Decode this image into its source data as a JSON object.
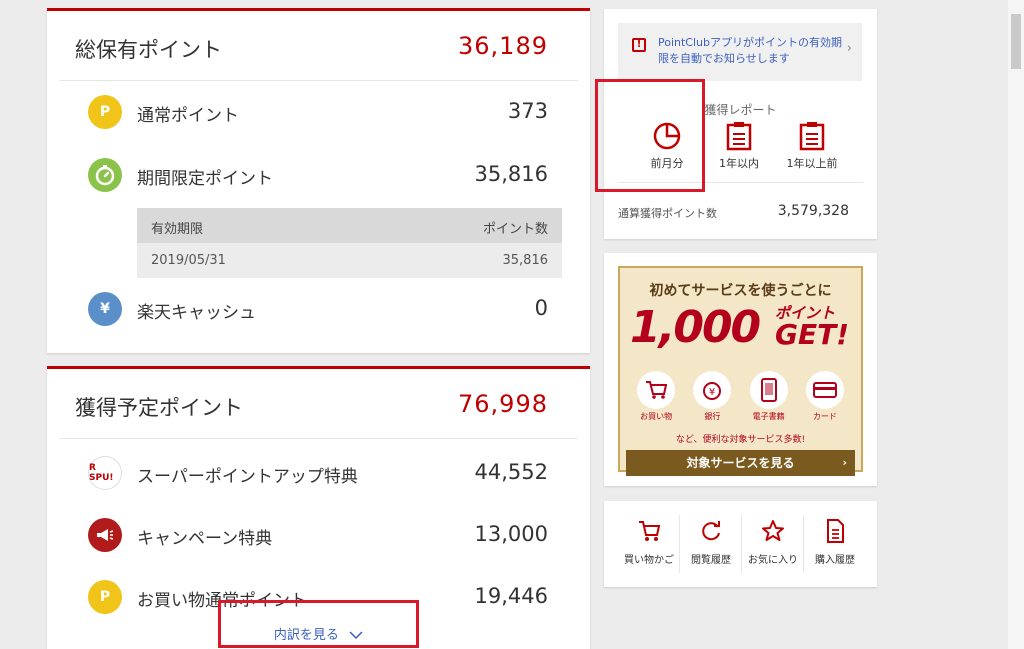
{
  "total": {
    "title": "総保有ポイント",
    "value": "36,189",
    "rows": [
      {
        "icon": "P",
        "label": "通常ポイント",
        "value": "373"
      },
      {
        "label": "期間限定ポイント",
        "value": "35,816"
      },
      {
        "icon": "¥",
        "label": "楽天キャッシュ",
        "value": "0"
      }
    ],
    "expiry": {
      "head_left": "有効期限",
      "head_right": "ポイント数",
      "date": "2019/05/31",
      "points": "35,816"
    }
  },
  "planned": {
    "title": "獲得予定ポイント",
    "value": "76,998",
    "rows": [
      {
        "icon": "R SPU!",
        "label": "スーパーポイントアップ特典",
        "value": "44,552"
      },
      {
        "label": "キャンペーン特典",
        "value": "13,000"
      },
      {
        "icon": "P",
        "label": "お買い物通常ポイント",
        "value": "19,446"
      }
    ],
    "breakdown": "内訳を見る"
  },
  "report": {
    "notice": "PointClubアプリがポイントの有効期限を自動でお知らせします",
    "title": "獲得レポート",
    "buttons": [
      "前月分",
      "1年以内",
      "1年以上前"
    ],
    "total_label": "通算獲得ポイント数",
    "total_value": "3,579,328"
  },
  "banner": {
    "line1": "初めてサービスを使うごとに",
    "big": "1,000",
    "sub1": "ポイント",
    "sub2": "GET!",
    "items": [
      "お買い物",
      "銀行",
      "電子書籍",
      "カード"
    ],
    "note": "など、便利な対象サービス多数!",
    "button": "対象サービスを見る"
  },
  "shortcuts": [
    "買い物かご",
    "閲覧履歴",
    "お気に入り",
    "購入履歴"
  ],
  "colors": {
    "accent": "#bf0000",
    "link": "#3a5fbf",
    "highlight": "#d9182a"
  }
}
